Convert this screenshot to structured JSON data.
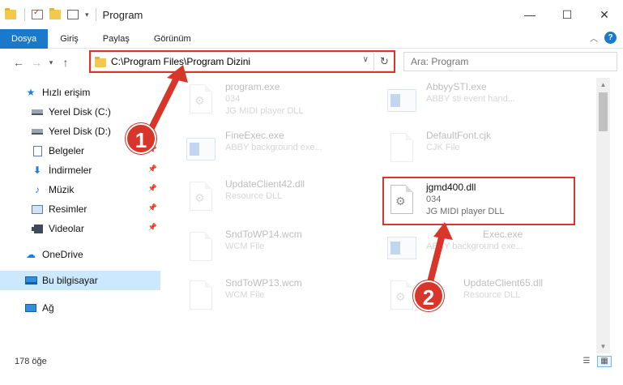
{
  "window": {
    "title": "Program",
    "buttons": {
      "minimize": "—",
      "maximize": "☐",
      "close": "✕"
    }
  },
  "ribbon": {
    "tabs": [
      {
        "label": "Dosya",
        "active": true
      },
      {
        "label": "Giriş"
      },
      {
        "label": "Paylaş"
      },
      {
        "label": "Görünüm"
      }
    ],
    "collapse_icon": "chevron-up-icon",
    "help": "?"
  },
  "nav": {
    "address": "C:\\Program Files\\Program Dizini",
    "search_placeholder": "Ara: Program"
  },
  "sidebar": {
    "items": [
      {
        "label": "Hızlı erişim",
        "icon": "star-icon"
      },
      {
        "label": "Yerel Disk (C:)",
        "icon": "drive-icon"
      },
      {
        "label": "Yerel Disk (D:)",
        "icon": "drive-icon"
      },
      {
        "label": "Belgeler",
        "icon": "documents-icon",
        "pinned": true
      },
      {
        "label": "İndirmeler",
        "icon": "downloads-icon",
        "pinned": true
      },
      {
        "label": "Müzik",
        "icon": "music-icon",
        "pinned": true
      },
      {
        "label": "Resimler",
        "icon": "pictures-icon",
        "pinned": true
      },
      {
        "label": "Videolar",
        "icon": "videos-icon",
        "pinned": true
      },
      {
        "label": "OneDrive",
        "icon": "cloud-icon"
      },
      {
        "label": "Bu bilgisayar",
        "icon": "computer-icon",
        "selected": true
      },
      {
        "label": "Ağ",
        "icon": "network-icon"
      }
    ]
  },
  "files": [
    {
      "name": "program.exe",
      "line1": "034",
      "line2": "JG MIDI player DLL",
      "icon": "gear-file-icon"
    },
    {
      "name": "AbbyySTI.exe",
      "line1": "ABBY sti event hand...",
      "line2": "",
      "icon": "app-icon"
    },
    {
      "name": "FineExec.exe",
      "line1": "ABBY background exe...",
      "line2": "",
      "icon": "app-icon"
    },
    {
      "name": "DefaultFont.cjk",
      "line1": "CJK File",
      "line2": "",
      "icon": "blank-file-icon"
    },
    {
      "name": "UpdateClient42.dll",
      "line1": "Resource DLL",
      "line2": "",
      "icon": "gear-file-icon"
    },
    {
      "name": "jgmd400.dll",
      "line1": "034",
      "line2": "JG MIDI player DLL",
      "icon": "gear-file-icon",
      "highlighted": true
    },
    {
      "name": "SndToWP14.wcm",
      "line1": "WCM File",
      "line2": "",
      "icon": "blank-file-icon"
    },
    {
      "name": "Exec.exe",
      "line1": "ABBY background exe...",
      "line2": "",
      "icon": "app-icon"
    },
    {
      "name": "SndToWP13.wcm",
      "line1": "WCM File",
      "line2": "",
      "icon": "blank-file-icon"
    },
    {
      "name": "UpdateClient65.dll",
      "line1": "Resource DLL",
      "line2": "",
      "icon": "gear-file-icon"
    }
  ],
  "status": {
    "count": "178 öğe"
  },
  "annotations": {
    "step1": "1",
    "step2": "2",
    "color": "#d9362b"
  }
}
